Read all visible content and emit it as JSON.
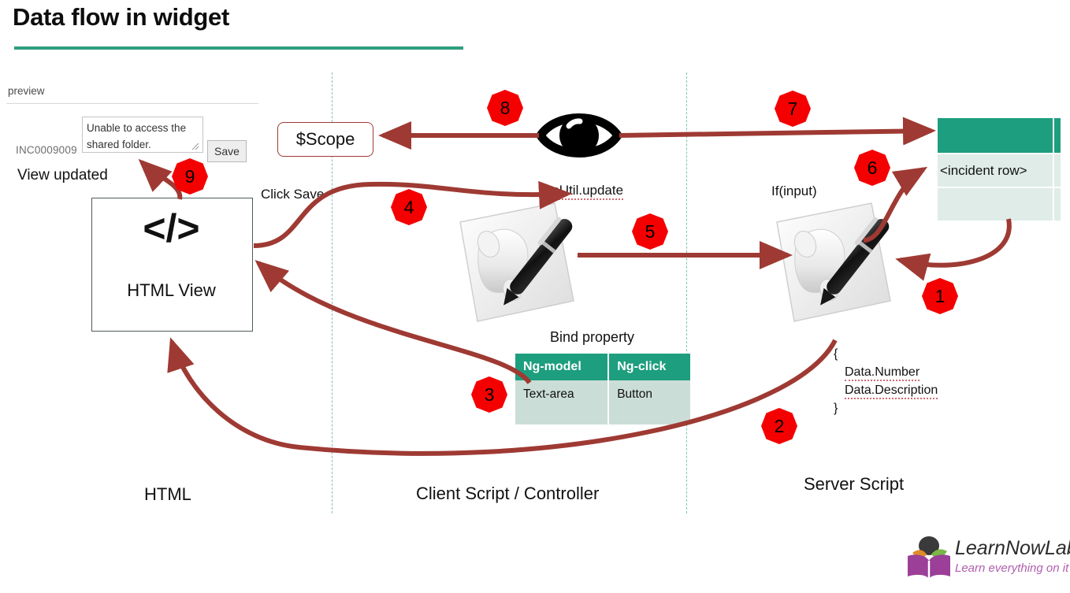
{
  "page": {
    "title": "Data flow in widget",
    "accent_teal": "#1d9e7e",
    "accent_red": "#9e3a33",
    "marker_red": "#f50000"
  },
  "preview": {
    "label": "preview",
    "incident_number": "INC0009009",
    "textarea_value": "Unable to access the shared folder.",
    "save_label": "Save",
    "status_text": "View updated"
  },
  "html_zone": {
    "code_glyph": "</>",
    "view_label": "HTML  View",
    "zone_label": "HTML"
  },
  "client_zone": {
    "scope_label": "$Scope",
    "click_save_label": "Click Save",
    "sputil_label": "SpUtil.update",
    "bind_property_label": "Bind property",
    "zone_label": "Client Script / Controller",
    "bind_table": {
      "headers": [
        "Ng-model",
        "Ng-click"
      ],
      "rows": [
        [
          "Text-area",
          "Button"
        ]
      ]
    }
  },
  "server_zone": {
    "if_input_label": "If(input)",
    "zone_label": "Server Script",
    "code_lines": [
      "{",
      "Data.Number",
      "Data.Description",
      "}"
    ],
    "incident_table": {
      "header_cells": [
        "",
        ""
      ],
      "rows": [
        [
          "<incident row>",
          ""
        ],
        [
          "",
          ""
        ]
      ]
    }
  },
  "steps": {
    "s1": "1",
    "s2": "2",
    "s3": "3",
    "s4": "4",
    "s5": "5",
    "s6": "6",
    "s7": "7",
    "s8": "8",
    "s9": "9"
  },
  "logo": {
    "name": "LearnNowLab",
    "tagline": "Learn everything on it"
  }
}
